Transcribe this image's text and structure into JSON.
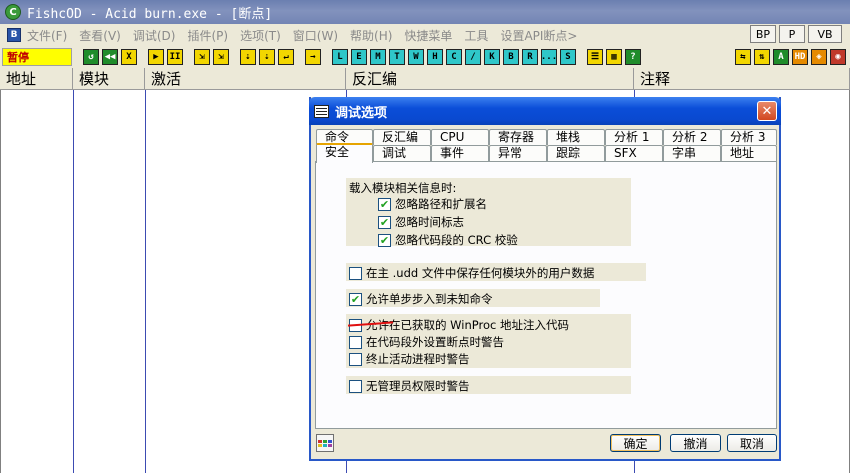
{
  "window": {
    "title": "FishcOD - Acid burn.exe - [断点]",
    "icon_label": "C"
  },
  "menu": {
    "system_icon_label": "B",
    "items": [
      "文件(F)",
      "查看(V)",
      "调试(D)",
      "插件(P)",
      "选项(T)",
      "窗口(W)",
      "帮助(H)",
      "快捷菜单",
      "工具",
      "设置API断点>"
    ],
    "right_buttons": [
      "BP",
      "P",
      "VB"
    ]
  },
  "toolbar": {
    "status": "暂停",
    "debug_buttons": [
      "↺",
      "◀◀",
      "X",
      "▶",
      "II",
      "⇲",
      "⇲",
      "⇣",
      "⇣",
      "↵",
      "→"
    ],
    "window_buttons": [
      "L",
      "E",
      "M",
      "T",
      "W",
      "H",
      "C",
      "/",
      "K",
      "B",
      "R",
      "...",
      "S"
    ],
    "misc_buttons": [
      "☰",
      "▦",
      "?"
    ],
    "right_buttons": [
      "⇆",
      "⇅",
      "A",
      "HD",
      "◈",
      "◉"
    ]
  },
  "columns": [
    "地址",
    "模块",
    "激活",
    "反汇编",
    "注释"
  ],
  "dialog": {
    "title": "调试选项",
    "close_glyph": "✕",
    "tabs_row1": [
      "命令",
      "反汇编",
      "CPU",
      "寄存器",
      "堆栈",
      "分析 1",
      "分析 2",
      "分析 3"
    ],
    "tabs_row2": [
      "安全",
      "调试",
      "事件",
      "异常",
      "跟踪",
      "SFX",
      "字串",
      "地址"
    ],
    "active_tab": "安全",
    "group1": {
      "label": "载入模块相关信息时:",
      "options": [
        {
          "label": "忽略路径和扩展名",
          "checked": true
        },
        {
          "label": "忽略时间标志",
          "checked": true
        },
        {
          "label": "忽略代码段的 CRC 校验",
          "checked": true
        }
      ]
    },
    "opt_udd": {
      "label": "在主 .udd 文件中保存任何模块外的用户数据",
      "checked": false
    },
    "opt_step": {
      "label": "允许单步步入到未知命令",
      "checked": true
    },
    "group3": {
      "options": [
        {
          "label": "允许在已获取的 WinProc 地址注入代码",
          "checked": false
        },
        {
          "label": "在代码段外设置断点时警告",
          "checked": false
        },
        {
          "label": "终止活动进程时警告",
          "checked": false
        }
      ]
    },
    "opt_admin": {
      "label": "无管理员权限时警告",
      "checked": false
    },
    "buttons": {
      "ok": "确定",
      "cancel": "撤消",
      "close": "取消"
    },
    "check_glyph": "✔"
  },
  "colors": {
    "title_bar": "#7385b4",
    "dialog_title": "#0a49d0",
    "status_bg": "#ffff00",
    "status_text": "#c00000",
    "annotation": "#e01010"
  }
}
